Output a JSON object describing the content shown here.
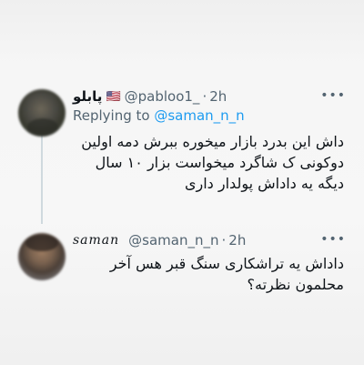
{
  "tweets": [
    {
      "display_name": "پابلو",
      "flag": "🇺🇸",
      "handle": "@pabloo1_",
      "time": "2h",
      "replying_prefix": "Replying to",
      "replying_to": "@saman_n_n",
      "text": "داش این بدرد بازار میخوره ببرش دمه اولین دوکونی ک شاگرد میخواست بزار ۱۰ سال دیگه یه داداش پولدار داری",
      "more_icon": "more-dots-icon"
    },
    {
      "display_name": "saman",
      "handle": "@saman_n_n",
      "time": "2h",
      "text": "داداش یه تراشکاری سنگ قبر هس آخر محلمون نظرته؟",
      "more_icon": "more-dots-icon"
    }
  ],
  "colors": {
    "link": "#1d9bf0",
    "muted": "#536471",
    "text": "#0f1419",
    "thread_line": "#cfd9de"
  }
}
